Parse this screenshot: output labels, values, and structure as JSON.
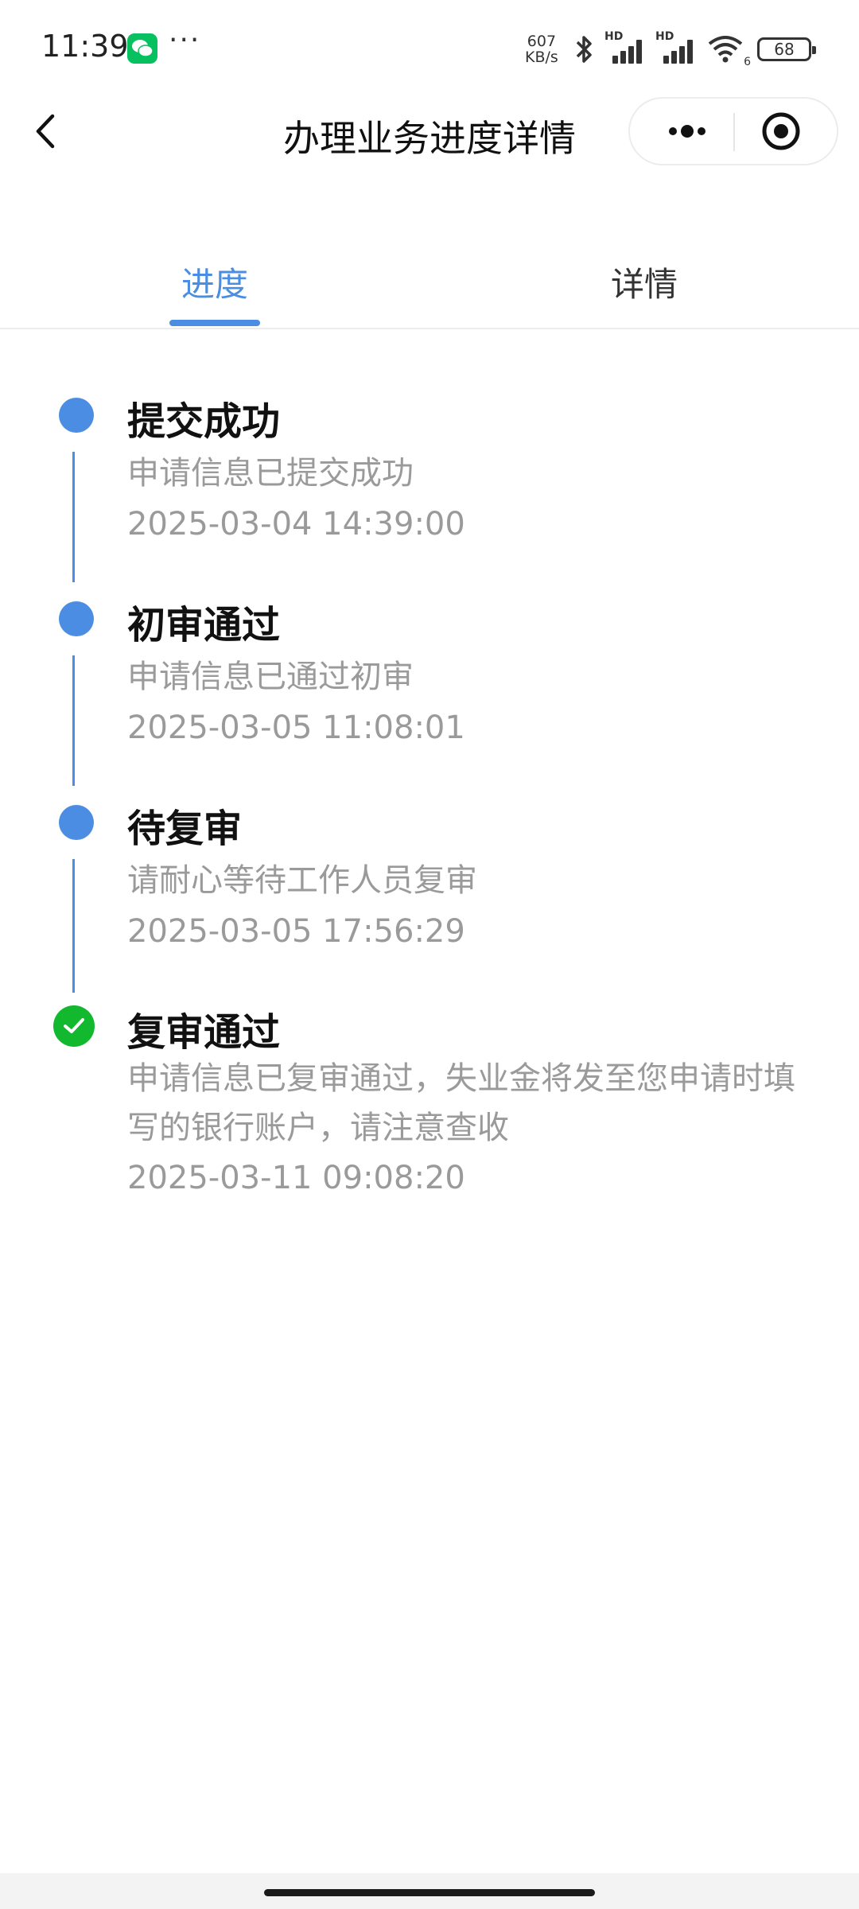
{
  "status_bar": {
    "time": "11:39",
    "more": "···",
    "net_speed_value": "607",
    "net_speed_unit": "KB/s",
    "hd1": "HD",
    "hd2": "HD",
    "wifi_sub": "6",
    "battery": "68"
  },
  "nav": {
    "title": "办理业务进度详情"
  },
  "tabs": [
    {
      "label": "进度",
      "active": true
    },
    {
      "label": "详情",
      "active": false
    }
  ],
  "timeline": [
    {
      "title": "提交成功",
      "desc": "申请信息已提交成功",
      "time": "2025-03-04 14:39:00",
      "state": "done"
    },
    {
      "title": "初审通过",
      "desc": "申请信息已通过初审",
      "time": "2025-03-05 11:08:01",
      "state": "done"
    },
    {
      "title": "待复审",
      "desc": "请耐心等待工作人员复审",
      "time": "2025-03-05 17:56:29",
      "state": "done"
    },
    {
      "title": "复审通过",
      "desc": "申请信息已复审通过，失业金将发至您申请时填写的银行账户，请注意查收",
      "time": "2025-03-11 09:08:20",
      "state": "current"
    }
  ],
  "colors": {
    "accent": "#4a8de3",
    "success": "#12b82e",
    "muted_text": "#9a9a9a"
  },
  "icons": {
    "back": "chevron-left-icon",
    "more": "more-dots-icon",
    "close": "target-circle-icon",
    "current_step": "check-circle-icon",
    "step": "dot-icon"
  }
}
